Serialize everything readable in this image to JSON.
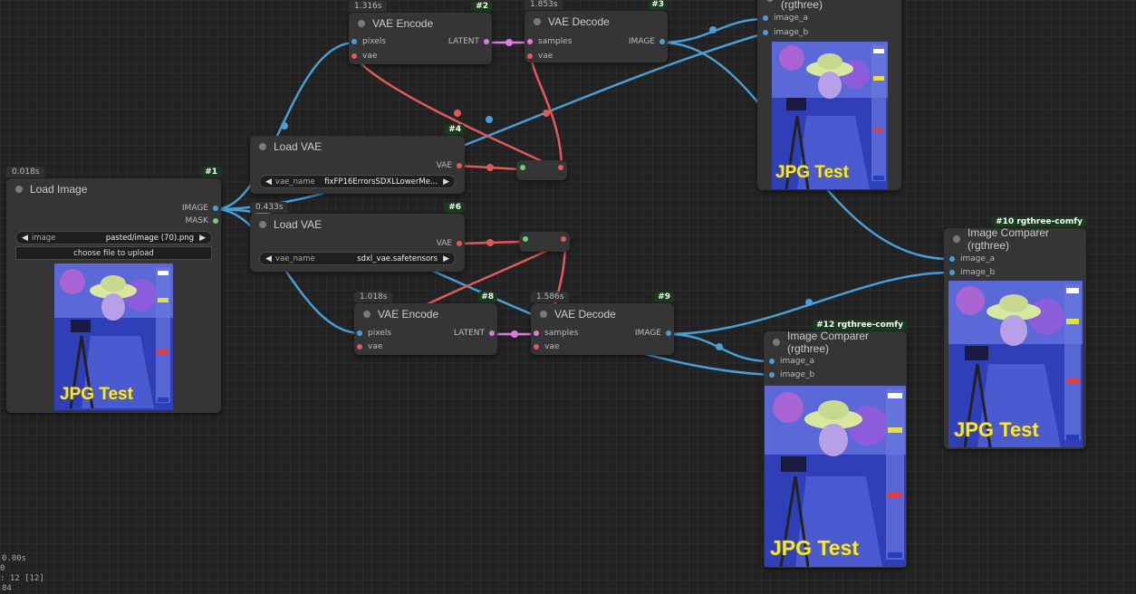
{
  "colors": {
    "image_wire": "#4a9ed6",
    "vae_wire": "#e05a5a",
    "latent_wire": "#e07ae0",
    "mask_wire": "#6fcf6f",
    "node_bg": "#353535",
    "canvas_bg": "#222222"
  },
  "nodes": {
    "load_image": {
      "title": "Load Image",
      "id": "#1",
      "time": "0.018s",
      "out_image": "IMAGE",
      "out_mask": "MASK",
      "widget_name": "image",
      "widget_value": "pasted/image (70).png",
      "upload_label": "choose file to upload",
      "thumb_caption": "JPG Test"
    },
    "vae_encode_2": {
      "title": "VAE Encode",
      "id": "#2",
      "time": "1.316s",
      "in_pixels": "pixels",
      "in_vae": "vae",
      "out_latent": "LATENT"
    },
    "vae_decode_3": {
      "title": "VAE Decode",
      "id": "#3",
      "time": "1.853s",
      "in_samples": "samples",
      "in_vae": "vae",
      "out_image": "IMAGE"
    },
    "load_vae_4": {
      "title": "Load VAE",
      "id": "#4",
      "out_vae": "VAE",
      "widget_name": "vae_name",
      "widget_value": "fixFP16ErrorsSDXLLowerMe..."
    },
    "load_vae_6": {
      "title": "Load VAE",
      "id": "#6",
      "time": "0.433s",
      "out_vae": "VAE",
      "widget_name": "vae_name",
      "widget_value": "sdxl_vae.safetensors"
    },
    "vae_encode_8": {
      "title": "VAE Encode",
      "id": "#8",
      "time": "1.018s",
      "in_pixels": "pixels",
      "in_vae": "vae",
      "out_latent": "LATENT"
    },
    "vae_decode_9": {
      "title": "VAE Decode",
      "id": "#9",
      "time": "1.586s",
      "in_samples": "samples",
      "in_vae": "vae",
      "out_image": "IMAGE"
    },
    "comparer_top": {
      "title": "Image Comparer (rgthree)",
      "in_a": "image_a",
      "in_b": "image_b",
      "thumb_caption": "JPG Test"
    },
    "comparer_10": {
      "title": "Image Comparer (rgthree)",
      "id": "#10 rgthree-comfy",
      "in_a": "image_a",
      "in_b": "image_b",
      "thumb_caption": "JPG Test"
    },
    "comparer_12": {
      "title": "Image Comparer (rgthree)",
      "id": "#12 rgthree-comfy",
      "in_a": "image_a",
      "in_b": "image_b",
      "thumb_caption": "JPG Test"
    }
  },
  "stats": {
    "line1": "0.00s",
    "line2": "0",
    "line3": ": 12 [12]",
    "line4": "84"
  }
}
